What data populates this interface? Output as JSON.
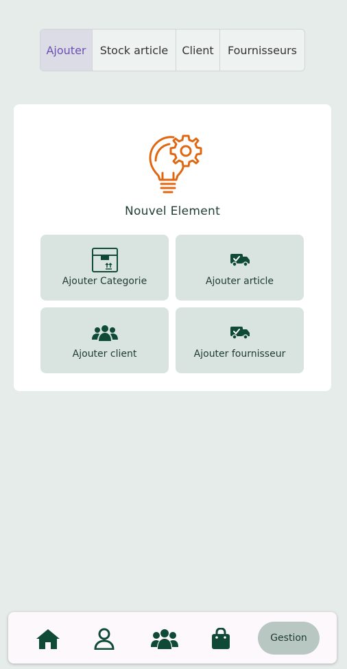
{
  "tabs": [
    {
      "label": "Ajouter",
      "active": true
    },
    {
      "label": "Stock article",
      "active": false
    },
    {
      "label": "Client",
      "active": false
    },
    {
      "label": "Fournisseurs",
      "active": false
    }
  ],
  "card": {
    "icon": "lightbulb-gear-icon",
    "title": "Nouvel Element",
    "tiles": [
      {
        "label": "Ajouter Categorie",
        "icon": "box-icon"
      },
      {
        "label": "Ajouter article",
        "icon": "delivery-truck-icon"
      },
      {
        "label": "Ajouter client",
        "icon": "users-group-icon"
      },
      {
        "label": "Ajouter fournisseur",
        "icon": "delivery-truck-icon"
      }
    ]
  },
  "bottom_nav": {
    "items": [
      {
        "icon": "home-icon"
      },
      {
        "icon": "user-icon"
      },
      {
        "icon": "users-group-icon"
      },
      {
        "icon": "shopping-bag-icon"
      }
    ],
    "active_label": "Gestion"
  },
  "colors": {
    "background": "#e6ecea",
    "accent_green": "#0f4a36",
    "icon_orange": "#e0660f",
    "active_tab_text": "#6b4fb2",
    "tile_bg": "#d9e3e0"
  }
}
